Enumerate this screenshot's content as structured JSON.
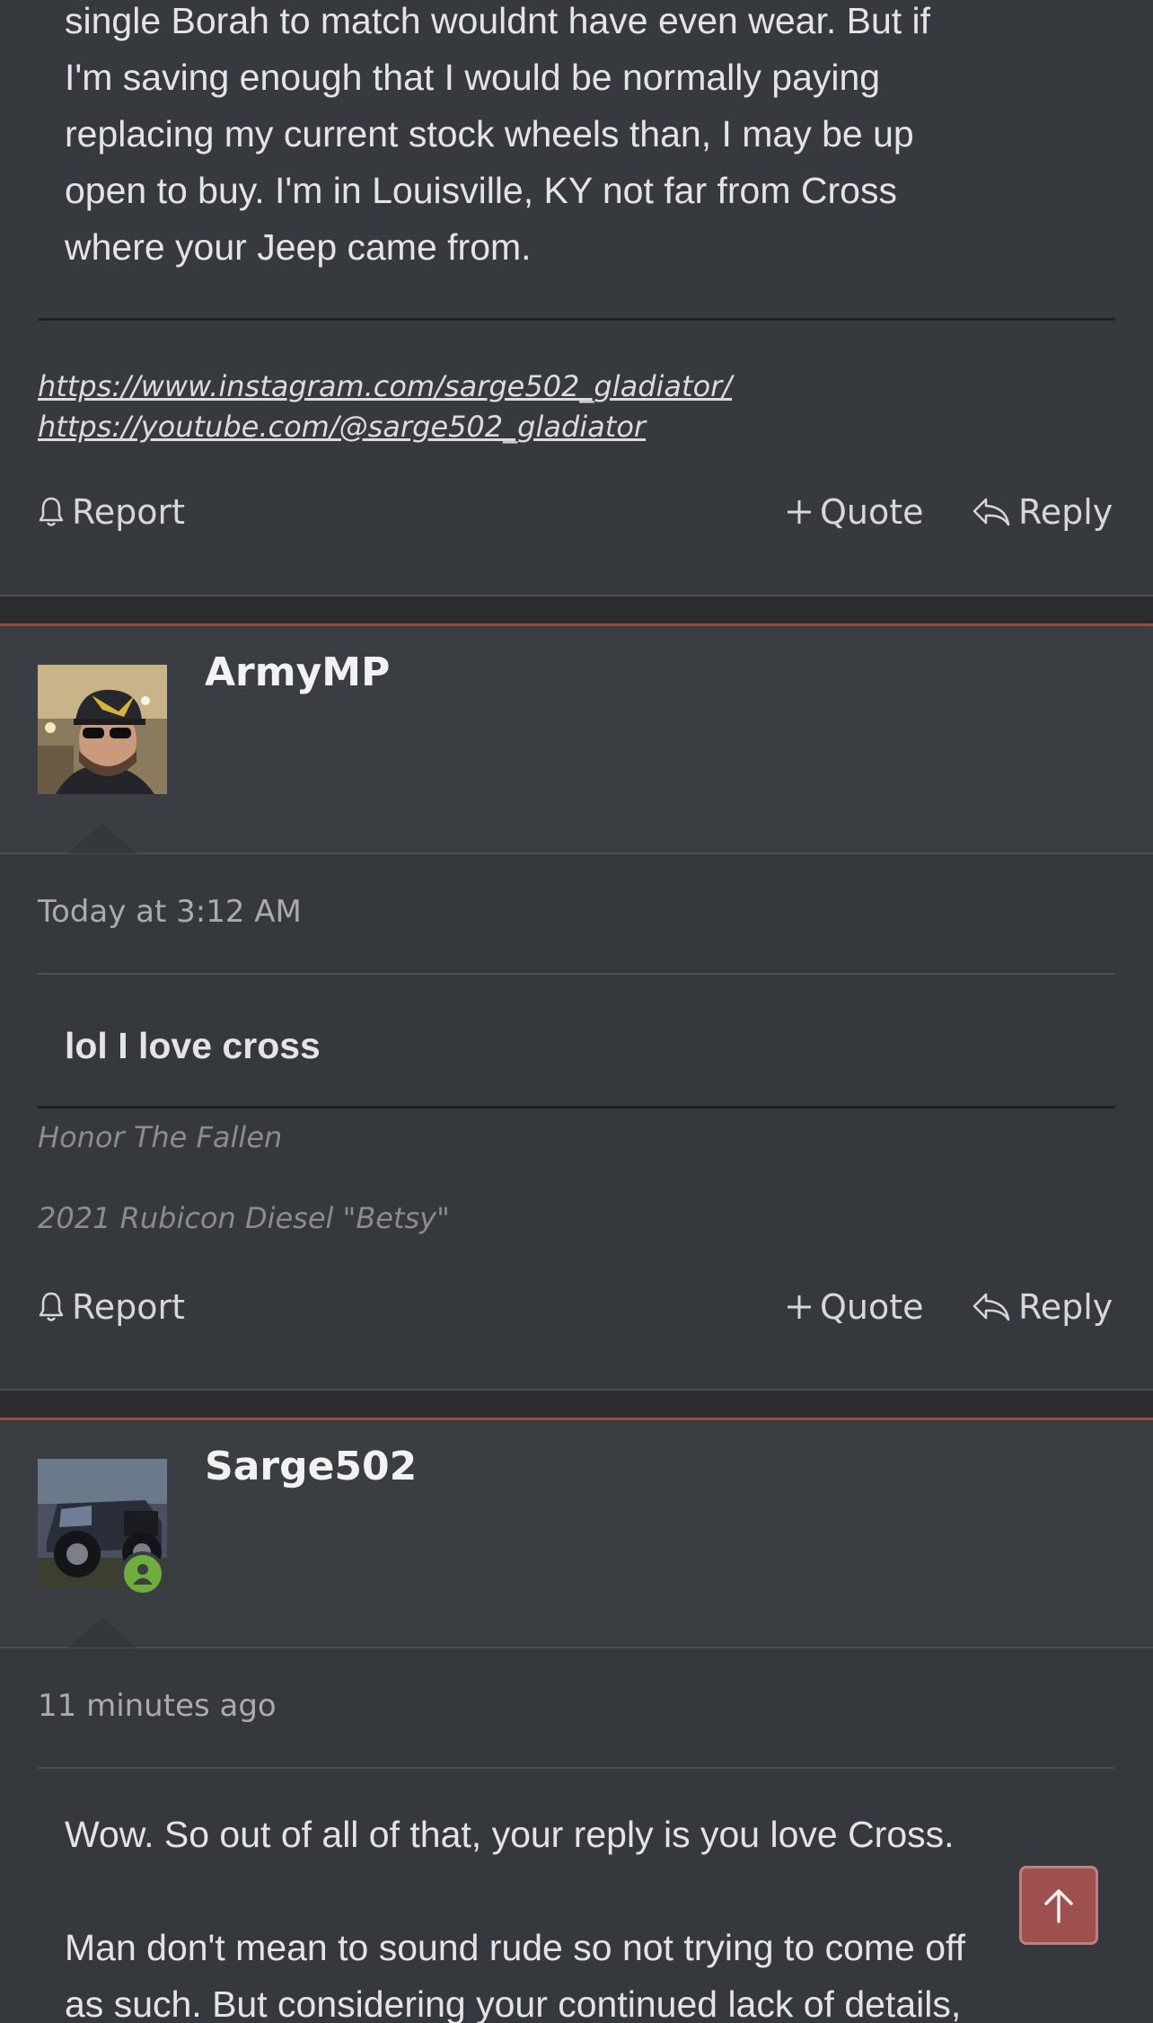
{
  "post_top": {
    "body_lines": [
      "single Borah to match wouldnt have even wear. But if",
      "I'm saving enough that I would be normally paying",
      "replacing my current stock wheels than, I may be up",
      "open to buy. I'm in Louisville, KY not far from Cross",
      "where your Jeep came from."
    ],
    "signature_links": [
      "https://www.instagram.com/sarge502_gladiator/",
      "https://youtube.com/@sarge502_gladiator"
    ],
    "actions": {
      "report": "Report",
      "quote": "Quote",
      "reply": "Reply"
    }
  },
  "post_armymp": {
    "username": "ArmyMP",
    "timestamp": "Today at 3:12 AM",
    "message": "lol I love cross",
    "signature": [
      "Honor The Fallen",
      "2021 Rubicon Diesel \"Betsy\""
    ],
    "actions": {
      "report": "Report",
      "quote": "Quote",
      "reply": "Reply"
    }
  },
  "post_sarge": {
    "username": "Sarge502",
    "timestamp": "11 minutes ago",
    "body_lines": [
      "Wow. So out of all of that, your reply is you love Cross.",
      "",
      "Man don't mean to sound rude so not trying to come off",
      "as such. But considering your continued lack of details,"
    ]
  },
  "icons": {
    "report": "bell-icon",
    "quote": "plus-icon",
    "reply": "reply-arrow-icon",
    "online": "user-online-icon",
    "scroll_top": "arrow-up-icon"
  },
  "colors": {
    "background": "#35383d",
    "accent": "#9a4a3a",
    "online": "#6fae3c",
    "scroll_button": "#a8514f"
  }
}
